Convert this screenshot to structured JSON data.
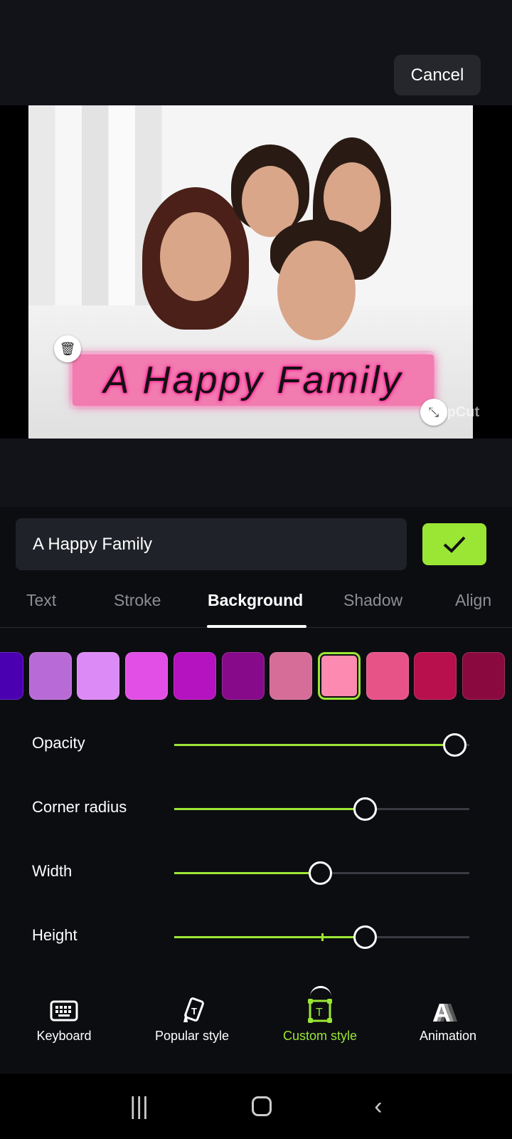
{
  "header": {
    "cancel_label": "Cancel"
  },
  "preview": {
    "caption": "A Happy Family",
    "watermark": "CapCut"
  },
  "editor": {
    "text_value": "A Happy Family",
    "confirm_icon": "check-icon"
  },
  "tabs": [
    {
      "label": "Text"
    },
    {
      "label": "Stroke"
    },
    {
      "label": "Background",
      "active": true
    },
    {
      "label": "Shadow"
    },
    {
      "label": "Align"
    }
  ],
  "swatches": [
    "#4a00b0",
    "#b86bd6",
    "#dc8af5",
    "#e24fe6",
    "#b512c0",
    "#860a8a",
    "#d56d98",
    "#fd8ab0",
    "#e75287",
    "#b8104c",
    "#8a0a40"
  ],
  "selected_swatch": "#fd8ab0",
  "sliders": [
    {
      "label": "Opacity",
      "value": 100
    },
    {
      "label": "Corner radius",
      "value": 68
    },
    {
      "label": "Width",
      "value": 52
    },
    {
      "label": "Height",
      "value": 68
    }
  ],
  "accent": "#9be635",
  "bottom_nav": [
    {
      "label": "Keyboard",
      "icon": "keyboard-icon"
    },
    {
      "label": "Popular style",
      "icon": "popular-style-icon"
    },
    {
      "label": "Custom style",
      "icon": "custom-style-icon",
      "active": true
    },
    {
      "label": "Animation",
      "icon": "animation-icon"
    }
  ]
}
